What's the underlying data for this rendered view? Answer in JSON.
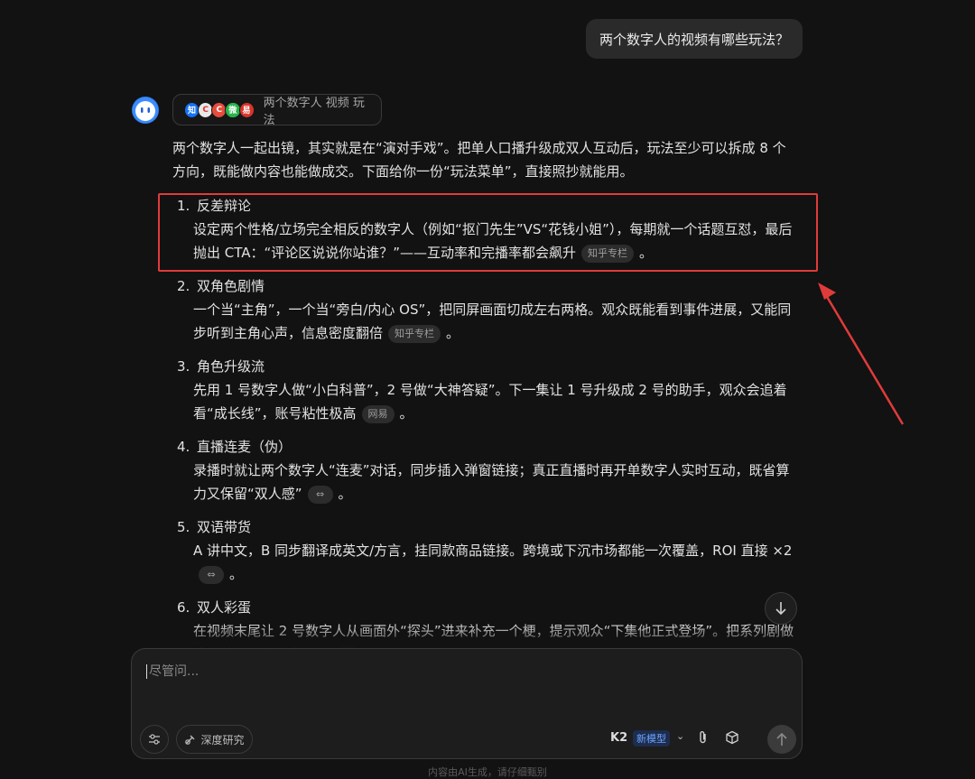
{
  "user_message": "两个数字人的视频有哪些玩法？",
  "search_chip": {
    "sources": [
      {
        "glyph": "知",
        "color": "#1772f6"
      },
      {
        "glyph": "C",
        "color": "#e8e8e8"
      },
      {
        "glyph": "C",
        "color": "#e74c3c"
      },
      {
        "glyph": "微",
        "color": "#28b44a"
      },
      {
        "glyph": "易",
        "color": "#d9342b"
      }
    ],
    "label": "两个数字人 视频 玩法"
  },
  "intro": "两个数字人一起出镜，其实就是在“演对手戏”。把单人口播升级成双人互动后，玩法至少可以拆成 8 个方向，既能做内容也能做成交。下面给你一份“玩法菜单”，直接照抄就能用。",
  "items": [
    {
      "num": "1.",
      "title": "反差辩论",
      "body": "设定两个性格/立场完全相反的数字人（例如“抠门先生”VS“花钱小姐”），每期就一个话题互怼，最后抛出 CTA：“评论区说说你站谁？”——互动率和完播率都会飙升",
      "tag": "知乎专栏",
      "end": "。"
    },
    {
      "num": "2.",
      "title": "双角色剧情",
      "body": "一个当“主角”，一个当“旁白/内心 OS”，把同屏画面切成左右两格。观众既能看到事件进展，又能同步听到主角心声，信息密度翻倍",
      "tag": "知乎专栏",
      "end": "。"
    },
    {
      "num": "3.",
      "title": "角色升级流",
      "body": "先用 1 号数字人做“小白科普”，2 号做“大神答疑”。下一集让 1 号升级成 2 号的助手，观众会追着看“成长线”，账号粘性极高",
      "tag": "网易",
      "end": "。"
    },
    {
      "num": "4.",
      "title": "直播连麦（伪）",
      "body": "录播时就让两个数字人“连麦”对话，同步插入弹窗链接；真正直播时再开单数字人实时互动，既省算力又保留“双人感”",
      "tag": "",
      "end": "。"
    },
    {
      "num": "5.",
      "title": "双语带货",
      "body": "A 讲中文，B 同步翻译成英文/方言，挂同款商品链接。跨境或下沉市场都能一次覆盖，ROI 直接 ×2",
      "tag": "",
      "end": "。"
    },
    {
      "num": "6.",
      "title": "双人彩蛋",
      "body": "在视频末尾让 2 号数字人从画面外“探头”进来补充一个梗，提示观众“下集他正式登场”。把系列剧做成连续剧，追更率暴涨",
      "tag": "",
      "end": "。"
    }
  ],
  "composer": {
    "placeholder": "尽管问...",
    "deep_research": "深度研究",
    "model_name": "K2",
    "model_badge": "新模型"
  },
  "footer": "内容由AI生成，请仔细甄别",
  "colors": {
    "annotation": "#e03b3b",
    "accent": "#2f7ff5"
  }
}
